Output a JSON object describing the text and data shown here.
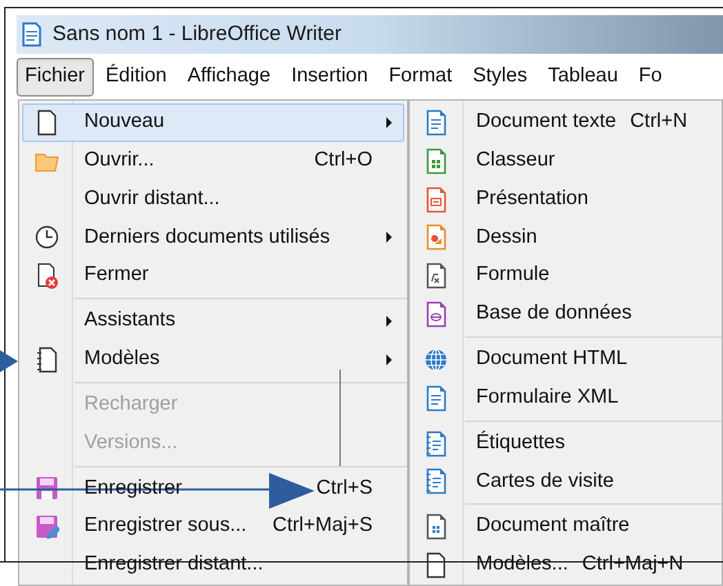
{
  "window": {
    "title": "Sans nom 1 - LibreOffice Writer"
  },
  "menubar": [
    {
      "label": "Fichier",
      "selected": true
    },
    {
      "label": "Édition",
      "selected": false
    },
    {
      "label": "Affichage",
      "selected": false
    },
    {
      "label": "Insertion",
      "selected": false
    },
    {
      "label": "Format",
      "selected": false
    },
    {
      "label": "Styles",
      "selected": false
    },
    {
      "label": "Tableau",
      "selected": false
    },
    {
      "label": "Fo",
      "selected": false
    }
  ],
  "file_menu": {
    "groups": [
      [
        {
          "label": "Nouveau",
          "submenu": true,
          "selected": true,
          "disabled": false
        },
        {
          "label": "Ouvrir...",
          "shortcut": "Ctrl+O",
          "submenu": false,
          "selected": false,
          "disabled": false
        },
        {
          "label": "Ouvrir distant...",
          "submenu": false,
          "selected": false,
          "disabled": false
        },
        {
          "label": "Derniers documents utilisés",
          "submenu": true,
          "selected": false,
          "disabled": false
        },
        {
          "label": "Fermer",
          "submenu": false,
          "selected": false,
          "disabled": false
        }
      ],
      [
        {
          "label": "Assistants",
          "submenu": true,
          "selected": false,
          "disabled": false
        },
        {
          "label": "Modèles",
          "submenu": true,
          "selected": false,
          "disabled": false
        }
      ],
      [
        {
          "label": "Recharger",
          "submenu": false,
          "selected": false,
          "disabled": true
        },
        {
          "label": "Versions...",
          "submenu": false,
          "selected": false,
          "disabled": true
        }
      ],
      [
        {
          "label": "Enregistrer",
          "shortcut": "Ctrl+S",
          "submenu": false,
          "selected": false,
          "disabled": false
        },
        {
          "label": "Enregistrer sous...",
          "shortcut": "Ctrl+Maj+S",
          "submenu": false,
          "selected": false,
          "disabled": false
        },
        {
          "label": "Enregistrer distant...",
          "submenu": false,
          "selected": false,
          "disabled": false
        }
      ]
    ]
  },
  "new_submenu": {
    "groups": [
      [
        {
          "label": "Document texte",
          "shortcut": "Ctrl+N"
        },
        {
          "label": "Classeur"
        },
        {
          "label": "Présentation"
        },
        {
          "label": "Dessin"
        },
        {
          "label": "Formule"
        },
        {
          "label": "Base de données"
        }
      ],
      [
        {
          "label": "Document HTML"
        },
        {
          "label": "Formulaire XML"
        }
      ],
      [
        {
          "label": "Étiquettes"
        },
        {
          "label": "Cartes de visite"
        }
      ],
      [
        {
          "label": "Document maître"
        },
        {
          "label": "Modèles...",
          "shortcut": "Ctrl+Maj+N"
        }
      ]
    ]
  }
}
